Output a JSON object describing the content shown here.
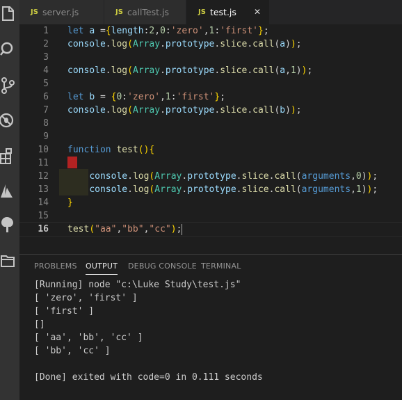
{
  "tabs": [
    {
      "icon": "JS",
      "label": "server.js"
    },
    {
      "icon": "JS",
      "label": "callTest.js"
    },
    {
      "icon": "JS",
      "label": "test.js",
      "close": "✕"
    }
  ],
  "editor": {
    "line_numbers": [
      "1",
      "2",
      "3",
      "4",
      "5",
      "6",
      "7",
      "8",
      "9",
      "10",
      "11",
      "12",
      "13",
      "14",
      "15",
      "16"
    ]
  },
  "panel": {
    "tabs": [
      "PROBLEMS",
      "OUTPUT",
      "DEBUG CONSOLE",
      "TERMINAL"
    ],
    "output": [
      "[Running] node \"c:\\Luke Study\\test.js\"",
      "[ 'zero', 'first' ]",
      "[ 'first' ]",
      "[]",
      "[ 'aa', 'bb', 'cc' ]",
      "[ 'bb', 'cc' ]",
      "",
      "[Done] exited with code=0 in 0.111 seconds"
    ]
  },
  "activity_icons": [
    "explorer-icon",
    "search-icon",
    "source-control-icon",
    "debug-icon",
    "extensions-icon",
    "azure-icon",
    "tree-icon",
    "folder-icon"
  ]
}
